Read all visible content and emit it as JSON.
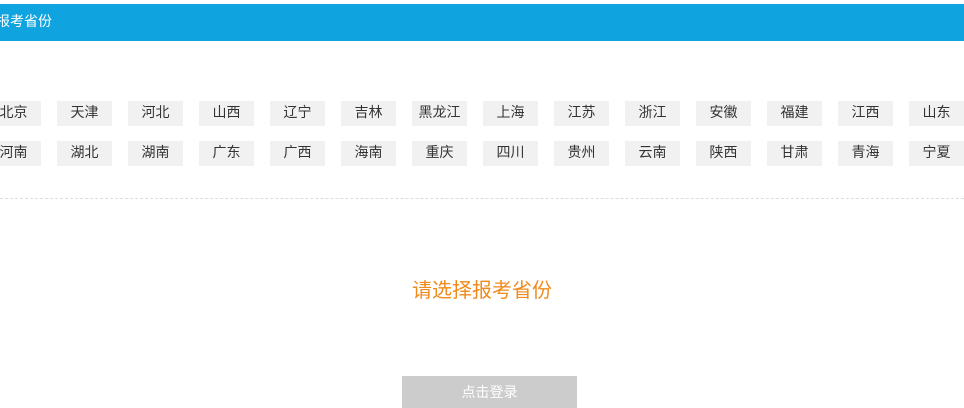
{
  "header": {
    "title": "报考省份"
  },
  "provinces": {
    "row1": [
      "北京",
      "天津",
      "河北",
      "山西",
      "辽宁",
      "吉林",
      "黑龙江",
      "上海",
      "江苏",
      "浙江",
      "安徽",
      "福建",
      "江西",
      "山东"
    ],
    "row2": [
      "河南",
      "湖北",
      "湖南",
      "广东",
      "广西",
      "海南",
      "重庆",
      "四川",
      "贵州",
      "云南",
      "陕西",
      "甘肃",
      "青海",
      "宁夏"
    ]
  },
  "prompt": "请选择报考省份",
  "login_button": "点击登录",
  "colors": {
    "header_bg": "#0fa3e0",
    "prompt_text": "#f08a1c",
    "button_bg": "#cccccc",
    "province_bg": "#f1f1f1"
  }
}
